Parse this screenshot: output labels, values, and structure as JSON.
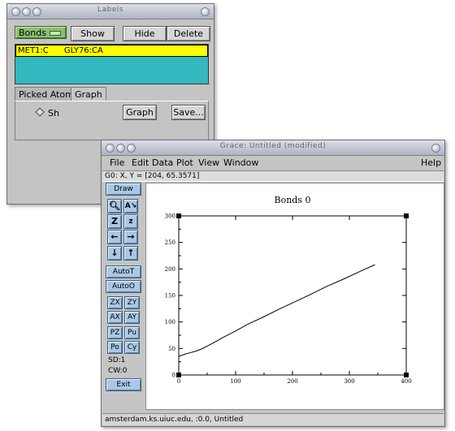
{
  "labels_window": {
    "title": "Labels",
    "mode_button": "Bonds",
    "show_button": "Show",
    "hide_button": "Hide",
    "delete_button": "Delete",
    "list_items": [
      {
        "text": "MET1:C      GLY76:CA",
        "selected": true
      }
    ],
    "tabs": [
      "Picked Atom",
      "Graph"
    ],
    "active_tab": "Graph",
    "radio_label": "Sh",
    "graph_button": "Graph",
    "save_button": "Save..."
  },
  "grace_window": {
    "title": "Grace: Untitled (modified)",
    "menu": [
      "File",
      "Edit",
      "Data",
      "Plot",
      "View",
      "Window",
      "Help"
    ],
    "coord_readout": "G0: X, Y = [204, 65.3571]",
    "toolbar": {
      "draw": "Draw",
      "zoom_icons": [
        "zoom-icon",
        "autoscale-text-icon",
        "zoom-out-z-icon",
        "zoom-in-z-icon",
        "left-arrow-icon",
        "right-arrow-icon",
        "down-arrow-icon",
        "up-arrow-icon"
      ],
      "autot": "AutoT",
      "autoo": "AutoO",
      "small_buttons": [
        "ZX",
        "ZY",
        "AX",
        "AY",
        "PZ",
        "Pu",
        "Po",
        "Cy"
      ],
      "sd": "SD:1",
      "cw": "CW:0",
      "exit": "Exit"
    },
    "status": "amsterdam.ks.uiuc.edu, :0.0, Untitled"
  },
  "chart_data": {
    "type": "line",
    "title": "Bonds 0",
    "xlabel": "",
    "ylabel": "",
    "xlim": [
      0,
      400
    ],
    "ylim": [
      0,
      300
    ],
    "xticks": [
      0,
      100,
      200,
      300,
      400
    ],
    "yticks": [
      0,
      50,
      100,
      150,
      200,
      250,
      300
    ],
    "grid": false,
    "series": [
      {
        "x": [
          0,
          10,
          20,
          30,
          40,
          60,
          80,
          100,
          120,
          150,
          180,
          200,
          230,
          260,
          290,
          320,
          345
        ],
        "y": [
          35,
          39,
          42,
          45,
          49,
          60,
          72,
          83,
          95,
          110,
          126,
          136,
          151,
          167,
          181,
          196,
          208
        ]
      }
    ]
  }
}
